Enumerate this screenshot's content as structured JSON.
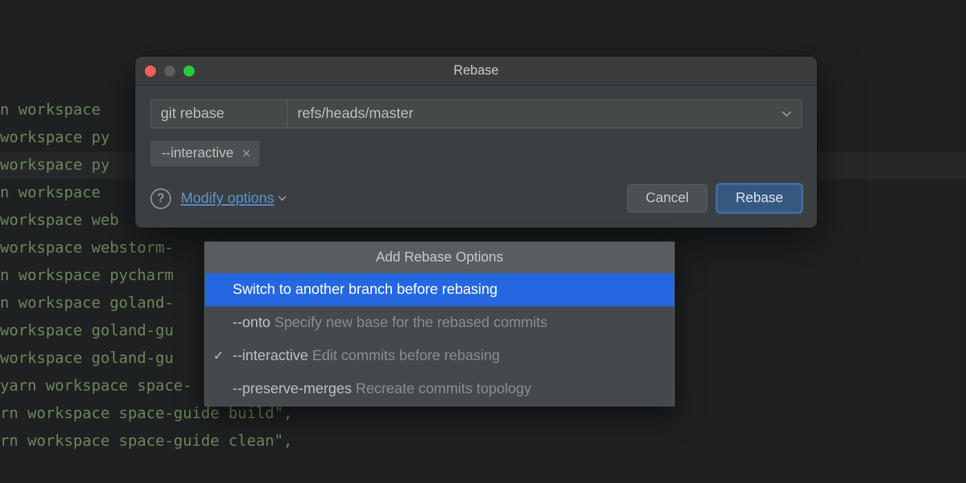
{
  "editor": {
    "lines": [
      "n workspace",
      "workspace py",
      "workspace py",
      "n workspace",
      "workspace web",
      "workspace webstorm-",
      "n workspace pycharm",
      "n workspace goland-",
      "workspace goland-gu",
      "workspace goland-gu",
      "yarn workspace space-",
      "rn workspace space-guide build\",",
      "rn workspace space-guide clean\","
    ],
    "highlight_index": 2
  },
  "dialog": {
    "title": "Rebase",
    "command_label": "git rebase",
    "ref_value": "refs/heads/master",
    "chip": {
      "label": "--interactive"
    },
    "modify_label": "Modify options",
    "cancel_label": "Cancel",
    "confirm_label": "Rebase"
  },
  "menu": {
    "header": "Add Rebase Options",
    "items": [
      {
        "label": "Switch to another branch before rebasing",
        "selected": true
      },
      {
        "flag": "--onto",
        "desc": "Specify new base for the rebased commits"
      },
      {
        "flag": "--interactive",
        "desc": "Edit commits before rebasing",
        "checked": true
      },
      {
        "flag": "--preserve-merges",
        "desc": "Recreate commits topology"
      }
    ]
  }
}
